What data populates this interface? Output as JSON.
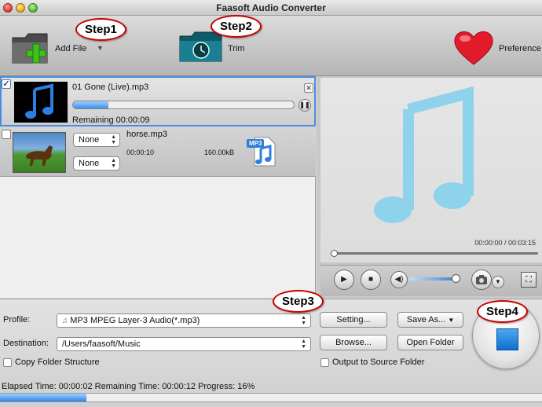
{
  "window": {
    "title": "Faasoft Audio Converter"
  },
  "toolbar": {
    "add_file_label": "Add File",
    "trim_label": "Trim",
    "preference_label": "Preference"
  },
  "steps": {
    "step1": "Step1",
    "step2": "Step2",
    "step3": "Step3",
    "step4": "Step4"
  },
  "files": [
    {
      "name": "01 Gone (Live).mp3",
      "checked": true,
      "remaining": "Remaining 00:00:09",
      "progress": 0.16
    },
    {
      "name": "horse.mp3",
      "checked": false,
      "audio_track": "None",
      "subtitle": "None",
      "duration": "00:00:10",
      "size": "160.00kB",
      "format_badge": "MP3"
    }
  ],
  "preview": {
    "time": "00:00:00 / 00:03:15",
    "volume": 0.95
  },
  "settings": {
    "profile_label": "Profile:",
    "profile_value": "MP3 MPEG Layer-3 Audio(*.mp3)",
    "destination_label": "Destination:",
    "destination_value": "/Users/faasoft/Music",
    "setting_button": "Setting...",
    "save_as_button": "Save As...",
    "browse_button": "Browse...",
    "open_folder_button": "Open Folder",
    "copy_folder_label": "Copy Folder Structure",
    "output_source_label": "Output to Source Folder"
  },
  "status": {
    "text": "Elapsed Time: 00:00:02 Remaining Time: 00:00:12 Progress: 16%",
    "progress": 0.16
  },
  "colors": {
    "accent": "#3a8ee8",
    "selection": "#4a8de0",
    "note": "#8fd2ec"
  }
}
